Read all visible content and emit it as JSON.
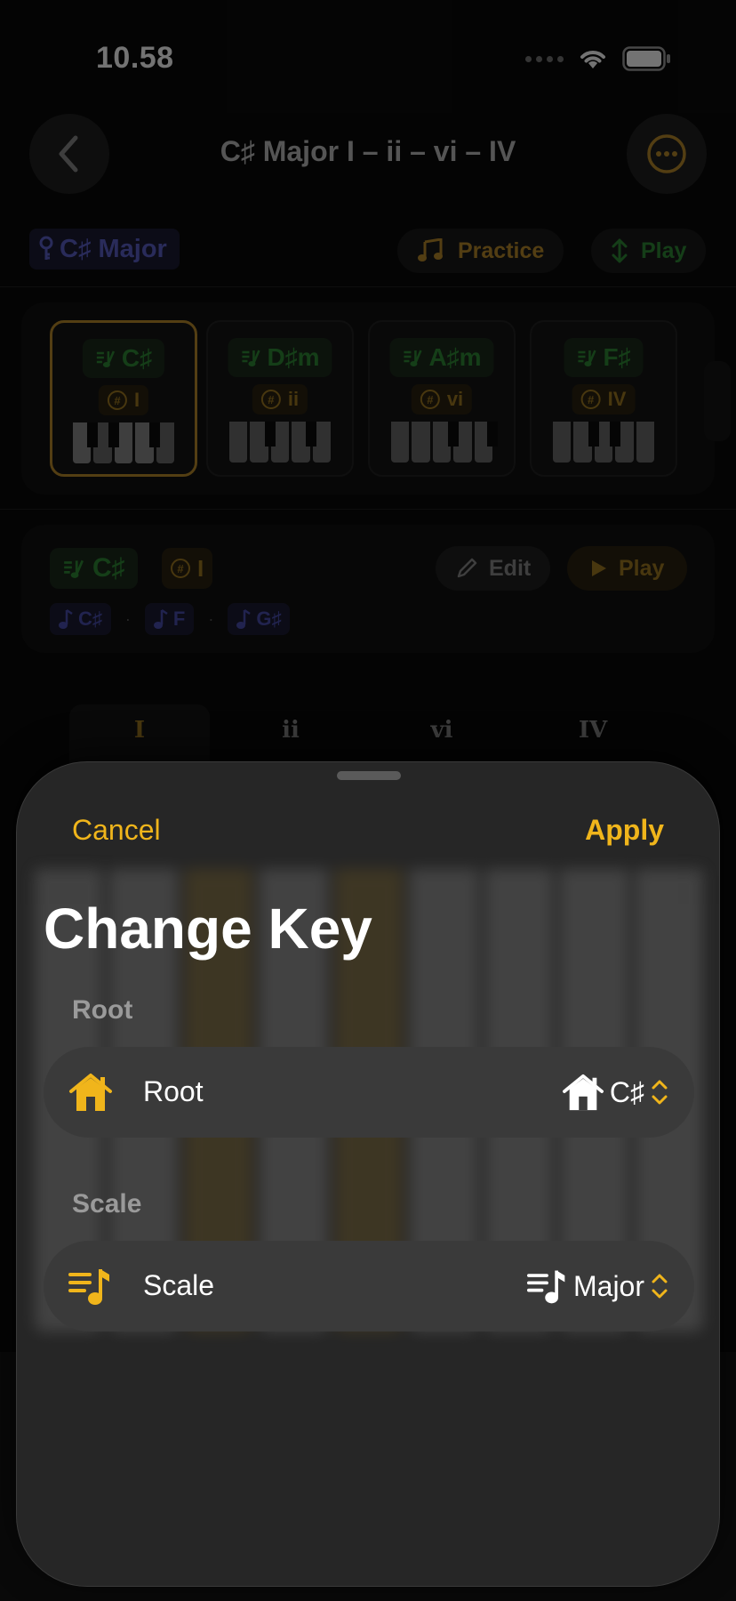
{
  "status_bar": {
    "time": "10.58"
  },
  "nav": {
    "title": "C♯ Major I – ii – vi – IV"
  },
  "key_chip": {
    "label": "C♯ Major"
  },
  "actions": {
    "practice": "Practice",
    "play": "Play"
  },
  "chords": [
    {
      "name": "C♯",
      "numeral": "I",
      "selected": true
    },
    {
      "name": "D♯m",
      "numeral": "ii",
      "selected": false
    },
    {
      "name": "A♯m",
      "numeral": "vi",
      "selected": false
    },
    {
      "name": "F♯",
      "numeral": "IV",
      "selected": false
    }
  ],
  "detail": {
    "chord": "C♯",
    "numeral": "I",
    "edit": "Edit",
    "play": "Play",
    "notes": [
      "C♯",
      "F",
      "G♯"
    ],
    "separator": "·"
  },
  "numerals": [
    "I",
    "ii",
    "vi",
    "IV"
  ],
  "sheet": {
    "cancel": "Cancel",
    "apply": "Apply",
    "title": "Change Key",
    "root_section": "Root",
    "root_label": "Root",
    "root_value": "C♯",
    "scale_section": "Scale",
    "scale_label": "Scale",
    "scale_value": "Major"
  },
  "colors": {
    "accent": "#f0b51b",
    "chord_green": "#2f8a36",
    "key_blue": "#5b5fc7",
    "sheet_bg": "#262626",
    "row_bg": "#3a3a3a"
  }
}
